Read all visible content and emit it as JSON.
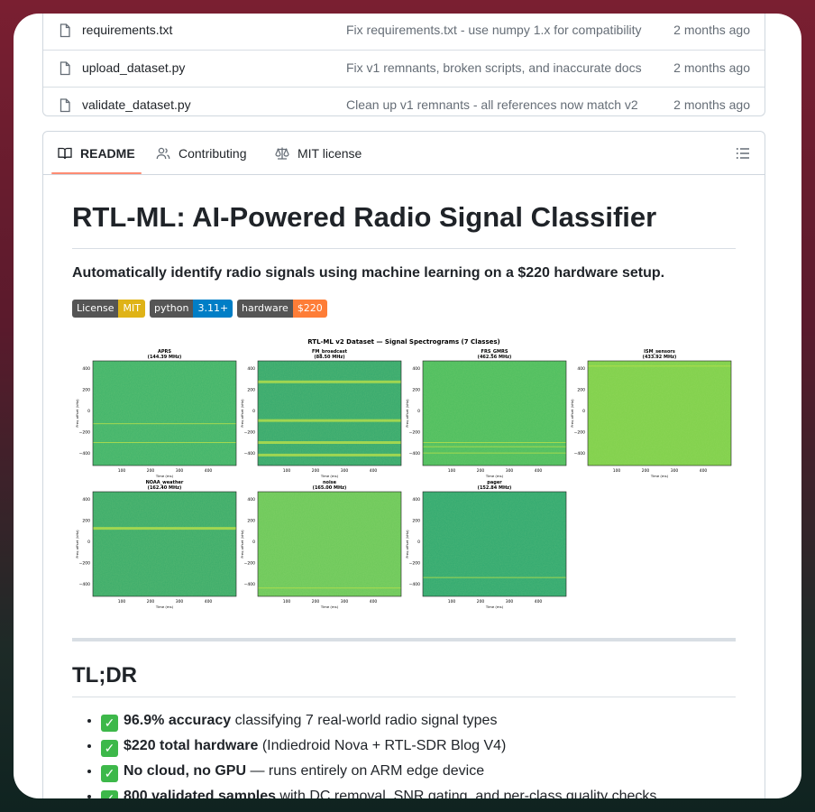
{
  "files": [
    {
      "name": "requirements.txt",
      "message": "Fix requirements.txt - use numpy 1.x for compatibility",
      "time": "2 months ago"
    },
    {
      "name": "upload_dataset.py",
      "message": "Fix v1 remnants, broken scripts, and inaccurate docs",
      "time": "2 months ago"
    },
    {
      "name": "validate_dataset.py",
      "message": "Clean up v1 remnants - all references now match v2",
      "time": "2 months ago"
    }
  ],
  "tabs": [
    {
      "label": "README",
      "icon": "book-icon"
    },
    {
      "label": "Contributing",
      "icon": "people-icon"
    },
    {
      "label": "MIT license",
      "icon": "law-icon"
    }
  ],
  "outline_icon": "list-icon",
  "readme": {
    "title": "RTL-ML: AI-Powered Radio Signal Classifier",
    "subtitle": "Automatically identify radio signals using machine learning on a $220 hardware setup.",
    "badges": [
      {
        "label": "License",
        "value": "MIT",
        "color": "#dfb317"
      },
      {
        "label": "python",
        "value": "3.11+",
        "color": "#007ec6"
      },
      {
        "label": "hardware",
        "value": "$220",
        "color": "#fe7d37"
      }
    ],
    "figure": {
      "title": "RTL-ML v2 Dataset — Signal Spectrograms (7 Classes)",
      "panels": [
        {
          "name": "APRS",
          "freq": "(144.39 MHz)"
        },
        {
          "name": "FM_broadcast",
          "freq": "(88.50 MHz)"
        },
        {
          "name": "FRS_GMRS",
          "freq": "(462.56 MHz)"
        },
        {
          "name": "ISM_sensors",
          "freq": "(433.92 MHz)"
        },
        {
          "name": "NOAA_weather",
          "freq": "(162.40 MHz)"
        },
        {
          "name": "noise",
          "freq": "(165.00 MHz)"
        },
        {
          "name": "pager",
          "freq": "(152.84 MHz)"
        }
      ],
      "xlabel": "Time (ms)",
      "ylabel": "Freq offset (kHz)",
      "yticks": [
        "400",
        "200",
        "0",
        "−200",
        "−400"
      ]
    },
    "tldr_heading": "TL;DR",
    "tldr": [
      {
        "bold": "96.9% accuracy",
        "rest": " classifying 7 real-world radio signal types"
      },
      {
        "bold": "$220 total hardware",
        "rest": " (Indiedroid Nova + RTL-SDR Blog V4)"
      },
      {
        "bold": "No cloud, no GPU",
        "rest": " — runs entirely on ARM edge device"
      },
      {
        "bold": "800 validated samples",
        "rest": " with DC removal, SNR gating, and per-class quality checks"
      }
    ]
  }
}
